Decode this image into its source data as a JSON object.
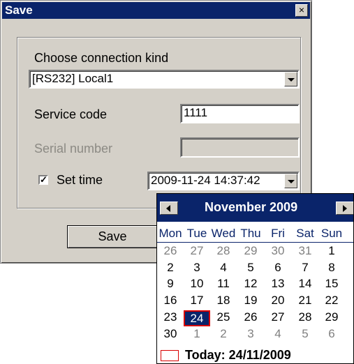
{
  "dialog": {
    "title": "Save",
    "close_glyph": "×",
    "connection_label": "Choose connection kind",
    "connection_value": "[RS232] Local1",
    "service_code_label": "Service code",
    "service_code_value": "1111",
    "serial_number_label": "Serial number",
    "serial_number_value": "",
    "set_time_label": "Set time",
    "set_time_checked": true,
    "check_glyph": "✓",
    "datetime_value": "2009-11-24 14:37:42",
    "save_label": "Save"
  },
  "calendar": {
    "month_title": "November 2009",
    "weekdays": [
      "Mon",
      "Tue",
      "Wed",
      "Thu",
      "Fri",
      "Sat",
      "Sun"
    ],
    "weeks": [
      [
        "26",
        "27",
        "28",
        "29",
        "30",
        "31",
        "1"
      ],
      [
        "2",
        "3",
        "4",
        "5",
        "6",
        "7",
        "8"
      ],
      [
        "9",
        "10",
        "11",
        "12",
        "13",
        "14",
        "15"
      ],
      [
        "16",
        "17",
        "18",
        "19",
        "20",
        "21",
        "22"
      ],
      [
        "23",
        "24",
        "25",
        "26",
        "27",
        "28",
        "29"
      ],
      [
        "30",
        "1",
        "2",
        "3",
        "4",
        "5",
        "6"
      ]
    ],
    "selected_day": "24",
    "today_label": "Today: 24/11/2009"
  },
  "colors": {
    "titlebar": "#0a246a",
    "dialog_bg": "#d4d0c8",
    "selected_border": "#d80000"
  }
}
